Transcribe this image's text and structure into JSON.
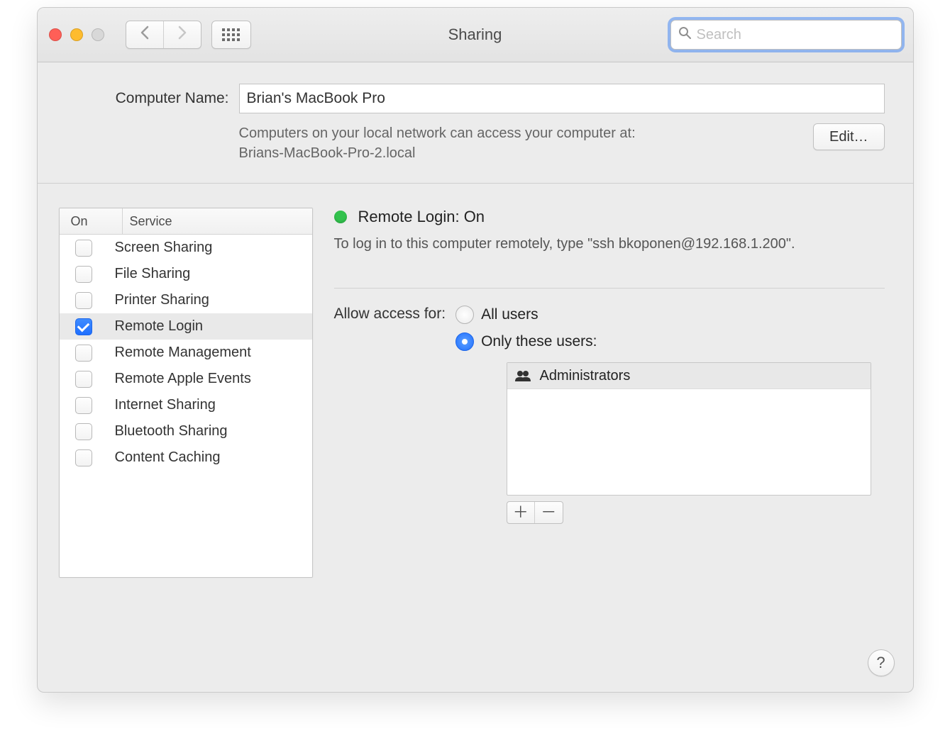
{
  "window": {
    "title": "Sharing"
  },
  "toolbar": {
    "search_placeholder": "Search"
  },
  "computer": {
    "label": "Computer Name:",
    "name": "Brian's MacBook Pro",
    "subtext_line1": "Computers on your local network can access your computer at:",
    "subtext_line2": "Brians-MacBook-Pro-2.local",
    "edit_label": "Edit…"
  },
  "services": {
    "col_on": "On",
    "col_service": "Service",
    "items": [
      {
        "label": "Screen Sharing",
        "on": false,
        "selected": false
      },
      {
        "label": "File Sharing",
        "on": false,
        "selected": false
      },
      {
        "label": "Printer Sharing",
        "on": false,
        "selected": false
      },
      {
        "label": "Remote Login",
        "on": true,
        "selected": true
      },
      {
        "label": "Remote Management",
        "on": false,
        "selected": false
      },
      {
        "label": "Remote Apple Events",
        "on": false,
        "selected": false
      },
      {
        "label": "Internet Sharing",
        "on": false,
        "selected": false
      },
      {
        "label": "Bluetooth Sharing",
        "on": false,
        "selected": false
      },
      {
        "label": "Content Caching",
        "on": false,
        "selected": false
      }
    ]
  },
  "detail": {
    "status_dot_color": "#32c24d",
    "status_text": "Remote Login: On",
    "instructions": "To log in to this computer remotely, type \"ssh bkoponen@192.168.1.200\".",
    "access_label": "Allow access for:",
    "radio_all": "All users",
    "radio_only": "Only these users:",
    "selected_radio": "only",
    "users": [
      {
        "name": "Administrators"
      }
    ]
  },
  "help_label": "?"
}
